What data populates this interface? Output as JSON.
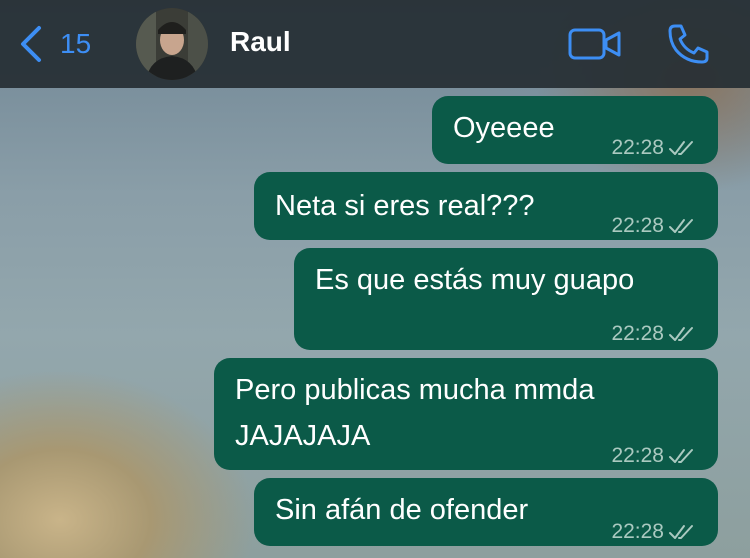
{
  "header": {
    "back_count": "15",
    "contact_name": "Raul",
    "icons": {
      "back": "chevron-left-icon",
      "video": "video-camera-icon",
      "call": "phone-icon"
    },
    "accent_color": "#3d8ef4"
  },
  "colors": {
    "bubble": "#0b5a48",
    "header_bg": "#262e34"
  },
  "messages": [
    {
      "text": "Oyeeee",
      "time": "22:28",
      "status": "read-double-check"
    },
    {
      "text": "Neta si eres real???",
      "time": "22:28",
      "status": "read-double-check"
    },
    {
      "text": "Es que estás muy guapo",
      "time": "22:28",
      "status": "read-double-check"
    },
    {
      "line1": "Pero publicas mucha mmda",
      "line2": "JAJAJAJA",
      "time": "22:28",
      "status": "read-double-check"
    },
    {
      "text": "Sin afán de ofender",
      "time": "22:28",
      "status": "read-double-check"
    }
  ]
}
